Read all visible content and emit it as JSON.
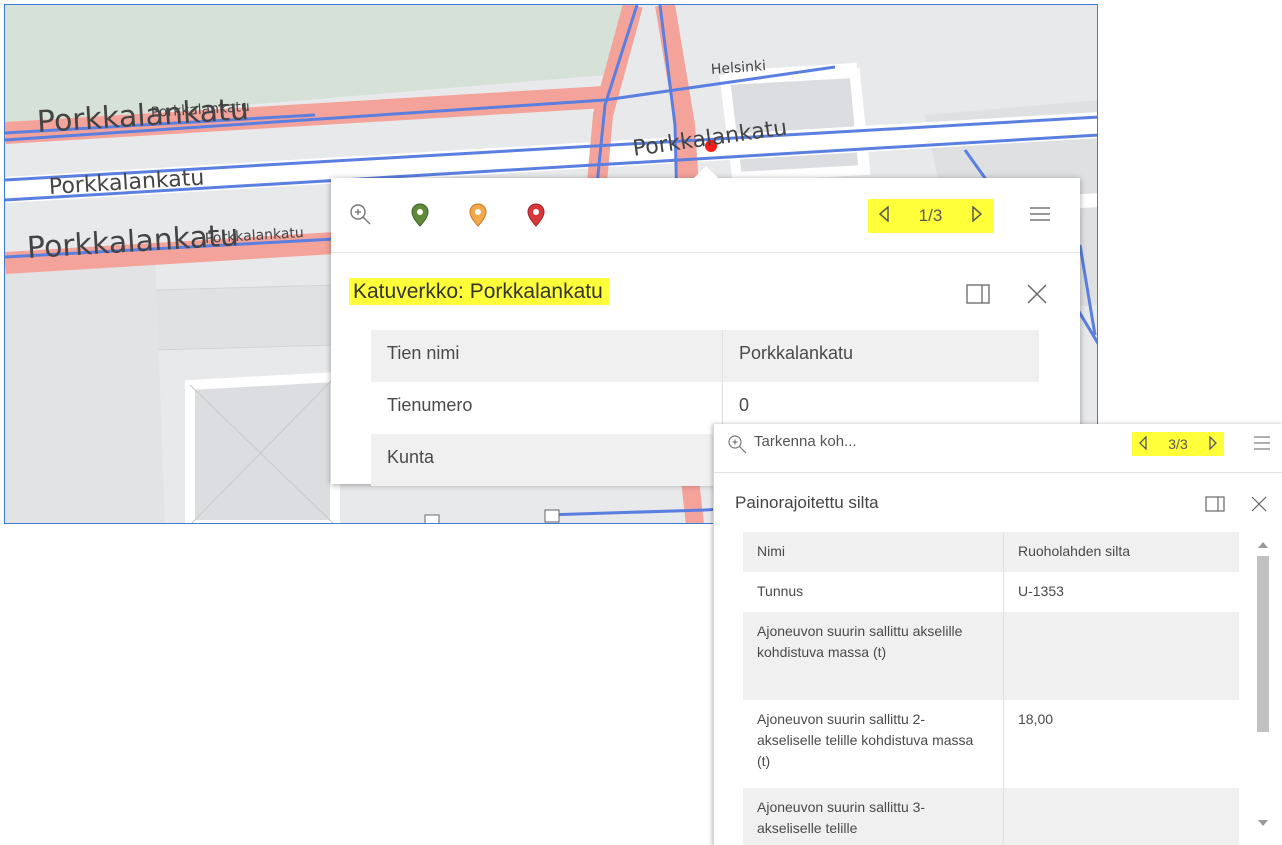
{
  "map": {
    "labels": {
      "porkkalankatu_large_1": "Porkkalankatu",
      "porkkalankatu_small_1": "Porkkalankatu",
      "porkkalankatu_medium": "Porkkalankatu",
      "porkkalankatu_large_2": "Porkkalankatu",
      "porkkalankatu_small_2": "Porkkalankatu",
      "porkkalankatu_right": "Porkkalankatu",
      "helsinki": "Helsinki"
    },
    "colors": {
      "road_pink": "#f4a39a",
      "route_blue": "#5b7fe0",
      "background": "#e8e9eb",
      "marker_red": "#ff1a1a"
    }
  },
  "popup1": {
    "toolbar": {
      "zoom_icon": "zoom-in-icon",
      "markers": [
        {
          "name": "green-marker-icon",
          "color": "#5e8a3a"
        },
        {
          "name": "orange-marker-icon",
          "color": "#f2a74a"
        },
        {
          "name": "red-marker-icon",
          "color": "#d9383a"
        }
      ],
      "page": "1/3",
      "menu_icon": "hamburger-menu-icon"
    },
    "title": "Katuverkko: Porkkalankatu",
    "rows": [
      {
        "key": "Tien nimi",
        "value": "Porkkalankatu"
      },
      {
        "key": "Tienumero",
        "value": "0"
      },
      {
        "key": "Kunta",
        "value": ""
      }
    ]
  },
  "popup2": {
    "search_placeholder": "Tarkenna koh...",
    "page": "3/3",
    "title": "Painorajoitettu silta",
    "rows": [
      {
        "key": "Nimi",
        "value": "Ruoholahden silta"
      },
      {
        "key": "Tunnus",
        "value": "U-1353"
      },
      {
        "key": "Ajoneuvon suurin sallittu akselille kohdistuva massa (t)",
        "value": ""
      },
      {
        "key": "Ajoneuvon suurin sallittu 2-akseliselle telille kohdistuva massa (t)",
        "value": "18,00"
      },
      {
        "key": "Ajoneuvon suurin sallittu 3-akseliselle telille",
        "value": ""
      }
    ]
  },
  "colors": {
    "highlight": "#ffff3a",
    "row_alt": "#f0f0f0"
  }
}
